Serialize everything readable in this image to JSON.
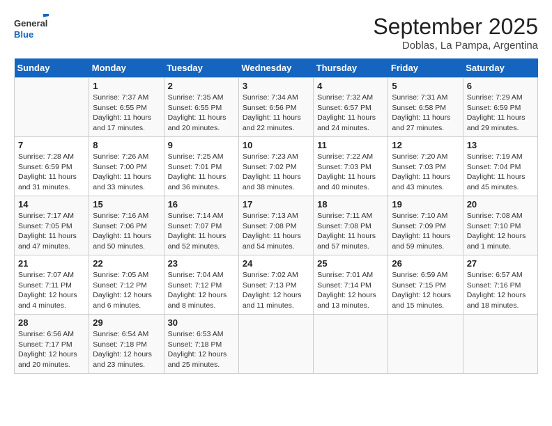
{
  "header": {
    "logo_line1": "General",
    "logo_line2": "Blue",
    "month": "September 2025",
    "location": "Doblas, La Pampa, Argentina"
  },
  "weekdays": [
    "Sunday",
    "Monday",
    "Tuesday",
    "Wednesday",
    "Thursday",
    "Friday",
    "Saturday"
  ],
  "weeks": [
    [
      {
        "day": "",
        "info": ""
      },
      {
        "day": "1",
        "info": "Sunrise: 7:37 AM\nSunset: 6:55 PM\nDaylight: 11 hours\nand 17 minutes."
      },
      {
        "day": "2",
        "info": "Sunrise: 7:35 AM\nSunset: 6:55 PM\nDaylight: 11 hours\nand 20 minutes."
      },
      {
        "day": "3",
        "info": "Sunrise: 7:34 AM\nSunset: 6:56 PM\nDaylight: 11 hours\nand 22 minutes."
      },
      {
        "day": "4",
        "info": "Sunrise: 7:32 AM\nSunset: 6:57 PM\nDaylight: 11 hours\nand 24 minutes."
      },
      {
        "day": "5",
        "info": "Sunrise: 7:31 AM\nSunset: 6:58 PM\nDaylight: 11 hours\nand 27 minutes."
      },
      {
        "day": "6",
        "info": "Sunrise: 7:29 AM\nSunset: 6:59 PM\nDaylight: 11 hours\nand 29 minutes."
      }
    ],
    [
      {
        "day": "7",
        "info": "Sunrise: 7:28 AM\nSunset: 6:59 PM\nDaylight: 11 hours\nand 31 minutes."
      },
      {
        "day": "8",
        "info": "Sunrise: 7:26 AM\nSunset: 7:00 PM\nDaylight: 11 hours\nand 33 minutes."
      },
      {
        "day": "9",
        "info": "Sunrise: 7:25 AM\nSunset: 7:01 PM\nDaylight: 11 hours\nand 36 minutes."
      },
      {
        "day": "10",
        "info": "Sunrise: 7:23 AM\nSunset: 7:02 PM\nDaylight: 11 hours\nand 38 minutes."
      },
      {
        "day": "11",
        "info": "Sunrise: 7:22 AM\nSunset: 7:03 PM\nDaylight: 11 hours\nand 40 minutes."
      },
      {
        "day": "12",
        "info": "Sunrise: 7:20 AM\nSunset: 7:03 PM\nDaylight: 11 hours\nand 43 minutes."
      },
      {
        "day": "13",
        "info": "Sunrise: 7:19 AM\nSunset: 7:04 PM\nDaylight: 11 hours\nand 45 minutes."
      }
    ],
    [
      {
        "day": "14",
        "info": "Sunrise: 7:17 AM\nSunset: 7:05 PM\nDaylight: 11 hours\nand 47 minutes."
      },
      {
        "day": "15",
        "info": "Sunrise: 7:16 AM\nSunset: 7:06 PM\nDaylight: 11 hours\nand 50 minutes."
      },
      {
        "day": "16",
        "info": "Sunrise: 7:14 AM\nSunset: 7:07 PM\nDaylight: 11 hours\nand 52 minutes."
      },
      {
        "day": "17",
        "info": "Sunrise: 7:13 AM\nSunset: 7:08 PM\nDaylight: 11 hours\nand 54 minutes."
      },
      {
        "day": "18",
        "info": "Sunrise: 7:11 AM\nSunset: 7:08 PM\nDaylight: 11 hours\nand 57 minutes."
      },
      {
        "day": "19",
        "info": "Sunrise: 7:10 AM\nSunset: 7:09 PM\nDaylight: 11 hours\nand 59 minutes."
      },
      {
        "day": "20",
        "info": "Sunrise: 7:08 AM\nSunset: 7:10 PM\nDaylight: 12 hours\nand 1 minute."
      }
    ],
    [
      {
        "day": "21",
        "info": "Sunrise: 7:07 AM\nSunset: 7:11 PM\nDaylight: 12 hours\nand 4 minutes."
      },
      {
        "day": "22",
        "info": "Sunrise: 7:05 AM\nSunset: 7:12 PM\nDaylight: 12 hours\nand 6 minutes."
      },
      {
        "day": "23",
        "info": "Sunrise: 7:04 AM\nSunset: 7:12 PM\nDaylight: 12 hours\nand 8 minutes."
      },
      {
        "day": "24",
        "info": "Sunrise: 7:02 AM\nSunset: 7:13 PM\nDaylight: 12 hours\nand 11 minutes."
      },
      {
        "day": "25",
        "info": "Sunrise: 7:01 AM\nSunset: 7:14 PM\nDaylight: 12 hours\nand 13 minutes."
      },
      {
        "day": "26",
        "info": "Sunrise: 6:59 AM\nSunset: 7:15 PM\nDaylight: 12 hours\nand 15 minutes."
      },
      {
        "day": "27",
        "info": "Sunrise: 6:57 AM\nSunset: 7:16 PM\nDaylight: 12 hours\nand 18 minutes."
      }
    ],
    [
      {
        "day": "28",
        "info": "Sunrise: 6:56 AM\nSunset: 7:17 PM\nDaylight: 12 hours\nand 20 minutes."
      },
      {
        "day": "29",
        "info": "Sunrise: 6:54 AM\nSunset: 7:18 PM\nDaylight: 12 hours\nand 23 minutes."
      },
      {
        "day": "30",
        "info": "Sunrise: 6:53 AM\nSunset: 7:18 PM\nDaylight: 12 hours\nand 25 minutes."
      },
      {
        "day": "",
        "info": ""
      },
      {
        "day": "",
        "info": ""
      },
      {
        "day": "",
        "info": ""
      },
      {
        "day": "",
        "info": ""
      }
    ]
  ]
}
